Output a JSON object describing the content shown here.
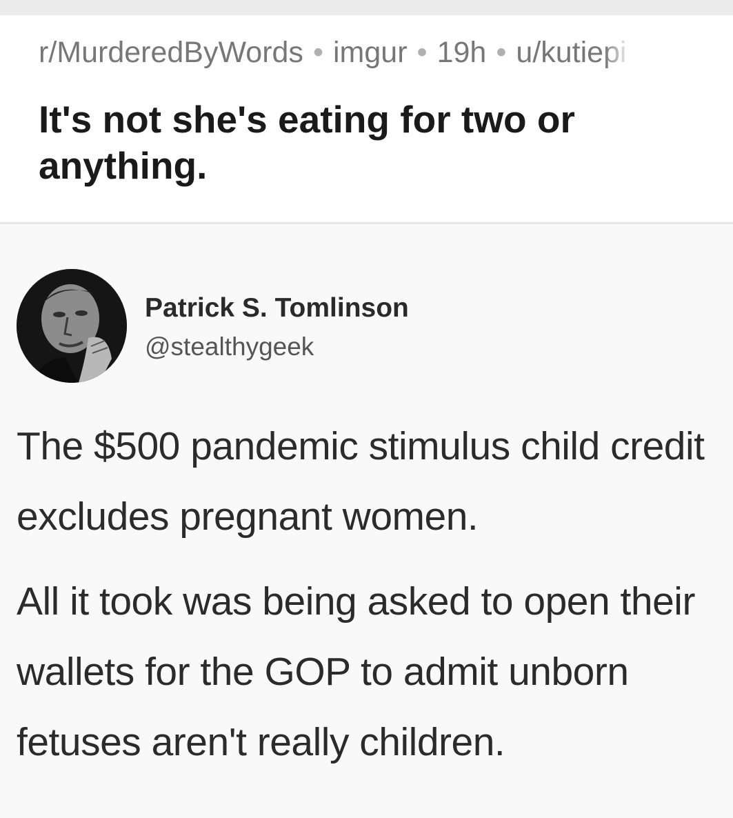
{
  "post": {
    "subreddit": "r/MurderedByWords",
    "source": "imgur",
    "age": "19h",
    "author": "u/kutiepi",
    "separator": "•",
    "title": "It's not she's eating for two or anything."
  },
  "tweet": {
    "display_name": "Patrick S. Tomlinson",
    "handle": "@stealthygeek",
    "paragraphs": [
      "The $500 pandemic stimulus child credit excludes pregnant women.",
      "All it took was being asked to open their wallets for the GOP to admit unborn fetuses aren't really children."
    ]
  },
  "colors": {
    "meta_text": "#777777",
    "title_text": "#1a1a1a",
    "tweet_text": "#2b2b2b"
  }
}
